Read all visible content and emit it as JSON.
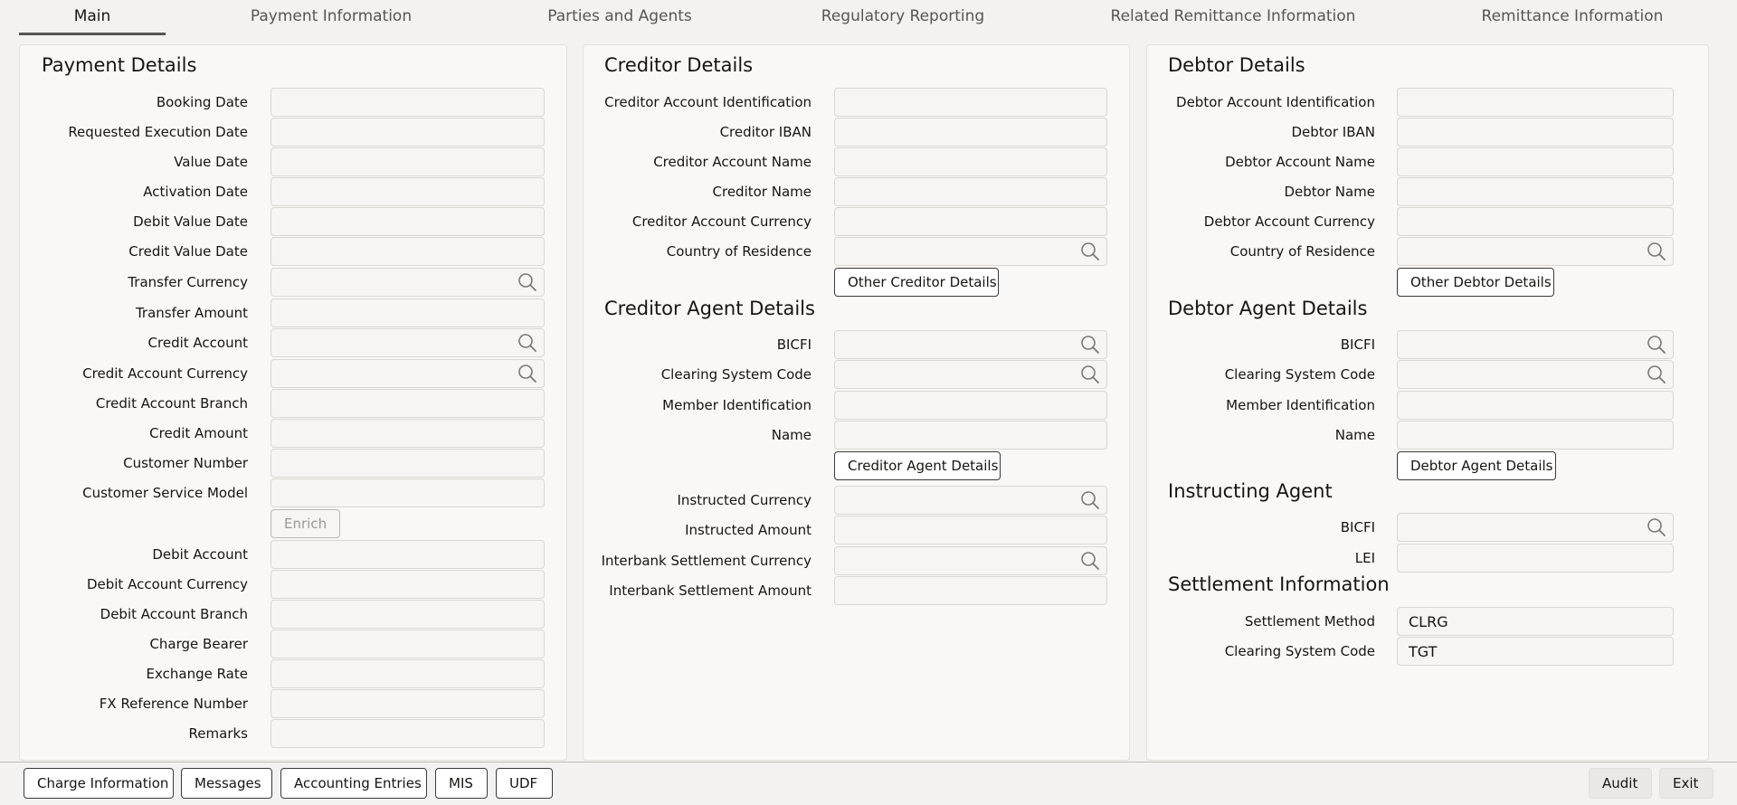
{
  "tabs": [
    "Main",
    "Payment Information",
    "Parties and Agents",
    "Regulatory Reporting",
    "Related Remittance Information",
    "Remittance Information"
  ],
  "payment_details": {
    "title": "Payment Details",
    "fields": [
      "Booking Date",
      "Requested Execution Date",
      "Value Date",
      "Activation Date",
      "Debit Value Date",
      "Credit Value Date",
      "Transfer Currency",
      "Transfer Amount",
      "Credit Account",
      "Credit Account Currency",
      "Credit Account Branch",
      "Credit Amount",
      "Customer Number",
      "Customer Service Model"
    ],
    "enrich_button": "Enrich",
    "fields2": [
      "Debit Account",
      "Debit Account Currency",
      "Debit Account Branch",
      "Charge Bearer",
      "Exchange Rate",
      "FX Reference Number",
      "Remarks"
    ]
  },
  "creditor_details": {
    "title": "Creditor Details",
    "fields": [
      "Creditor Account Identification",
      "Creditor IBAN",
      "Creditor Account Name",
      "Creditor Name",
      "Creditor Account Currency",
      "Country of Residence"
    ],
    "button": "Other Creditor Details"
  },
  "creditor_agent": {
    "title": "Creditor Agent Details",
    "fields": [
      "BICFI",
      "Clearing System Code",
      "Member Identification",
      "Name"
    ],
    "button": "Creditor Agent Details",
    "fields2": [
      "Instructed Currency",
      "Instructed Amount",
      "Interbank Settlement Currency",
      "Interbank Settlement Amount"
    ]
  },
  "debtor_details": {
    "title": "Debtor Details",
    "fields": [
      "Debtor Account Identification",
      "Debtor IBAN",
      "Debtor Account Name",
      "Debtor Name",
      "Debtor Account Currency",
      "Country of Residence"
    ],
    "button": "Other Debtor Details"
  },
  "debtor_agent": {
    "title": "Debtor Agent Details",
    "fields": [
      "BICFI",
      "Clearing System Code",
      "Member Identification",
      "Name"
    ],
    "button": "Debtor Agent Details"
  },
  "instructing_agent": {
    "title": "Instructing Agent",
    "fields": [
      "BICFI",
      "LEI"
    ]
  },
  "settlement": {
    "title": "Settlement Information",
    "fields": [
      "Settlement Method",
      "Clearing System Code"
    ],
    "values": [
      "CLRG",
      "TGT"
    ]
  },
  "footer": {
    "left_buttons": [
      "Charge Information",
      "Messages",
      "Accounting Entries",
      "MIS",
      "UDF"
    ],
    "audit": "Audit",
    "exit": "Exit"
  },
  "icons": {
    "lookup": "search-icon"
  }
}
